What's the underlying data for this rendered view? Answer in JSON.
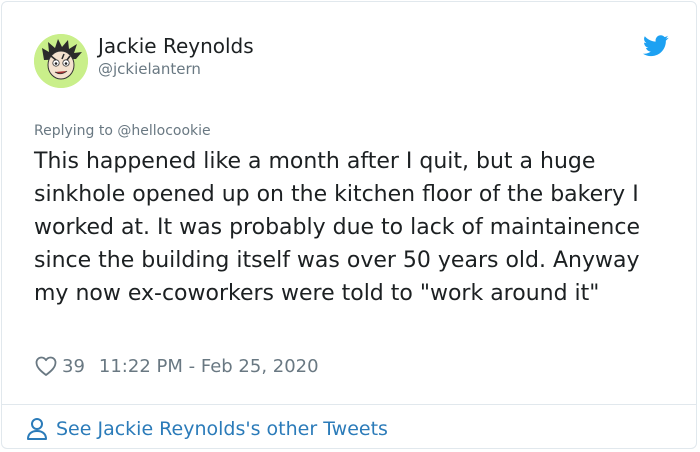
{
  "author": {
    "name": "Jackie Reynolds",
    "handle": "@jckielantern"
  },
  "replying": {
    "prefix": "Replying to ",
    "to": "@hellocookie"
  },
  "tweet": {
    "text": "This happened like a month after I quit, but a huge sinkhole opened up on the kitchen floor of the bakery I worked at. It was probably due to lack of maintainence since the building itself was over 50 years old. Anyway my now ex-coworkers were told to \"work around it\"",
    "likes": "39",
    "timestamp": "11:22 PM - Feb 25, 2020"
  },
  "footer": {
    "label": "See Jackie Reynolds's other Tweets"
  },
  "icons": {
    "brand": "twitter-bird-icon",
    "like": "heart-icon",
    "profile": "person-icon"
  },
  "colors": {
    "twitter_blue": "#1da1f2",
    "link_blue": "#2b7bb9",
    "text": "#1c2022",
    "muted": "#697882",
    "border": "#e1e8ed",
    "avatar_bg": "#c9ef8a"
  }
}
